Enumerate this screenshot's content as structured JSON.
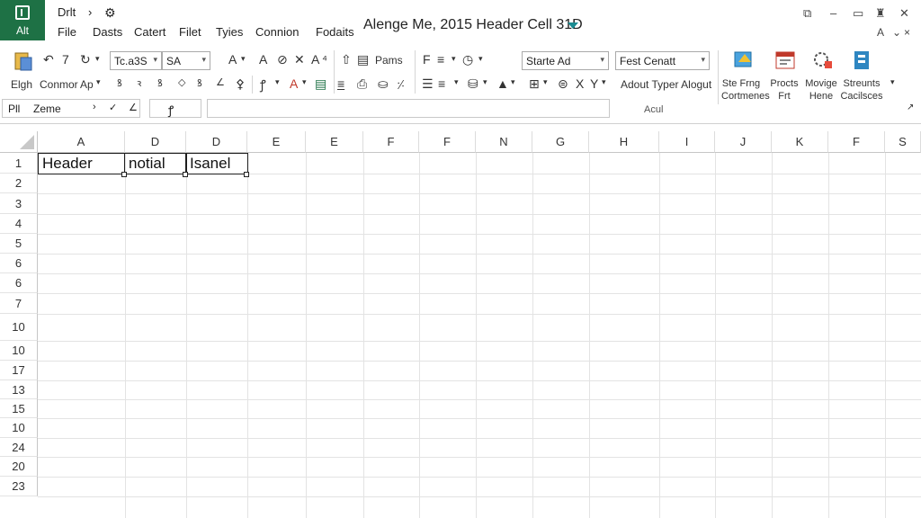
{
  "app": {
    "badge_label": "Alt"
  },
  "quick_access": {
    "item1": "Drlt",
    "item2": "›"
  },
  "menu": [
    "File",
    "Dasts",
    "Catert",
    "Filet",
    "Tyies",
    "Connion",
    "Fodaits"
  ],
  "title": "Alenge Me, 2015 Header Cell 31D",
  "ribbon": {
    "row1": {
      "font_name": "Tc.a3S",
      "font_size": "SA",
      "wrap_label": "Pams",
      "style_dropdown": "Starte Ad",
      "format_dropdown": "Fest Cenatt"
    },
    "row2": {
      "label_1": "Elgh",
      "label_2": "Conmor",
      "label_3": "Ap",
      "about_label": "Adout Typer Alogut"
    },
    "group_label": "Acul",
    "big_buttons": [
      {
        "line1": "Ste Frng",
        "line2": "Cortmenes"
      },
      {
        "line1": "Procts",
        "line2": "Frt"
      },
      {
        "line1": "Movige",
        "line2": "Hene"
      },
      {
        "line1": "Streunts",
        "line2": "Cacilsces"
      }
    ]
  },
  "formula_bar": {
    "name_box_prefix": "Pll",
    "name_box_value": "Zeme",
    "formula": ""
  },
  "grid": {
    "columns": [
      "A",
      "D",
      "D",
      "E",
      "E",
      "F",
      "F",
      "N",
      "G",
      "H",
      "I",
      "J",
      "K",
      "F",
      "S"
    ],
    "rows": [
      "1",
      "2",
      "3",
      "4",
      "5",
      "6",
      "6",
      "7",
      "10",
      "10",
      "17",
      "13",
      "15",
      "10",
      "24",
      "20",
      "23"
    ],
    "cells": [
      {
        "col": 0,
        "row": 0,
        "value": "Header"
      },
      {
        "col": 1,
        "row": 0,
        "value": "notial"
      },
      {
        "col": 2,
        "row": 0,
        "value": "Isanel"
      }
    ]
  },
  "colors": {
    "brand": "#1e7145",
    "accent": "#1a8c92",
    "gridline": "#e3e3e3"
  }
}
